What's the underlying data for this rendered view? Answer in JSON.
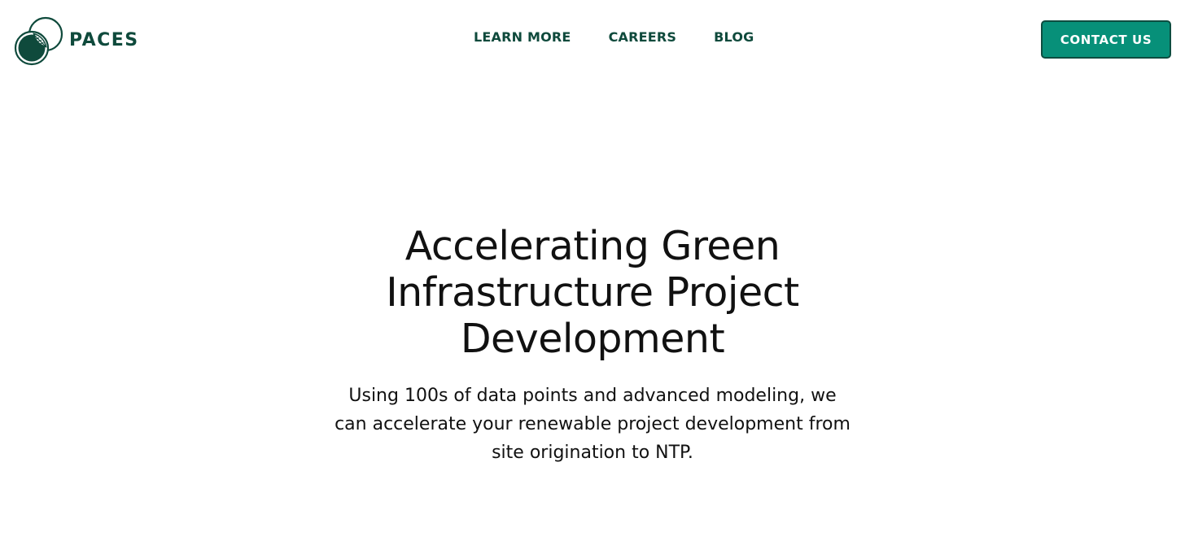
{
  "brand": {
    "name": "PACES",
    "primary_color": "#0f4a3c",
    "accent_color": "#079079",
    "logo_icon": "overlapping-circles-leaf-icon"
  },
  "nav": {
    "items": [
      {
        "label": "LEARN MORE"
      },
      {
        "label": "CAREERS"
      },
      {
        "label": "BLOG"
      }
    ]
  },
  "cta": {
    "label": "CONTACT US"
  },
  "hero": {
    "title": "Accelerating Green Infrastructure Project Development",
    "subtitle": "Using 100s of data points and advanced modeling, we can accelerate your renewable project development from site origination to NTP."
  }
}
